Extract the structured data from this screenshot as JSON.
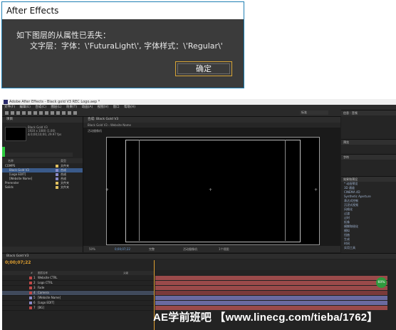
{
  "dialog": {
    "title": "After Effects",
    "message_line1": "如下图层的从属性已丢失：",
    "message_line2": "文字层：字体：\\'FuturaLight\\', 字体样式：\\'Regular\\'",
    "ok_label": "确定"
  },
  "ae": {
    "window_title": "Adobe After Effects - Black gold V3 REC Logo.aep *",
    "menu": [
      "文件(F)",
      "编辑(E)",
      "合成(C)",
      "图层(L)",
      "效果(T)",
      "动画(A)",
      "视图(V)",
      "窗口",
      "帮助(H)"
    ],
    "workspace": "标准",
    "search_placeholder": "搜索帮助",
    "project": {
      "tab": "项目",
      "comp_name": "Black Gold V3",
      "comp_meta": [
        "1920 x 1080 (1.00)",
        "Δ 0;00;10;00, 29.97 fps"
      ],
      "columns": [
        "名称",
        "类型"
      ],
      "items": [
        {
          "name": "COMPS",
          "type": "文件夹",
          "color": "#e0c060",
          "selected": false
        },
        {
          "name": "Black Gold V3",
          "type": "合成",
          "color": "#8a8ac8",
          "selected": true
        },
        {
          "name": "[Logo EDIT]",
          "type": "合成",
          "color": "#8a8ac8",
          "selected": false
        },
        {
          "name": "[Website Name]",
          "type": "合成",
          "color": "#8a8ac8",
          "selected": false
        },
        {
          "name": "Prerender",
          "type": "文件夹",
          "color": "#e0c060",
          "selected": false
        },
        {
          "name": "Solids",
          "type": "文件夹",
          "color": "#e0c060",
          "selected": false
        }
      ]
    },
    "comp": {
      "tab": "合成: Black Gold V3",
      "sub_tab": "Black Gold V3 ‹ Website Name",
      "label": "活动摄像机",
      "zoom": "50%",
      "timecode": "0;00;07;22",
      "resolution": "完整",
      "view": "1个视图"
    },
    "right_panels": {
      "info": "信息",
      "audio": "音频",
      "preview": "预览",
      "character": "字符",
      "effects": "效果和预设",
      "effects_list": [
        "* 动画预设",
        "3D 通道",
        "CINEMA 4D",
        "Synthetic Aperture",
        "表达式控制",
        "沉浸式视频",
        "风格化",
        "过渡",
        "过时",
        "抠像",
        "模糊和锐化",
        "模拟",
        "扭曲",
        "生成",
        "时间",
        "实用工具"
      ]
    },
    "timeline": {
      "tab": "Black Gold V3",
      "time": "0;00;07;22",
      "layer_cols": [
        "#",
        "图层名称",
        "父级"
      ],
      "layers": [
        {
          "n": "1",
          "name": "Website CTRL",
          "color": "#c04848",
          "selected": false
        },
        {
          "n": "2",
          "name": "Logo CTRL",
          "color": "#c04848",
          "selected": false
        },
        {
          "n": "3",
          "name": "Fade",
          "color": "#c04848",
          "selected": false
        },
        {
          "n": "4",
          "name": "Camera",
          "color": "#c04848",
          "selected": true
        },
        {
          "n": "5",
          "name": "[Website Name]",
          "color": "#8a8ac8",
          "selected": false
        },
        {
          "n": "6",
          "name": "[Logo EDIT]",
          "color": "#8a8ac8",
          "selected": false
        },
        {
          "n": "7",
          "name": "[BG]",
          "color": "#c04848",
          "selected": false
        }
      ],
      "ram_preview": "60%"
    }
  },
  "watermark": "AE学前班吧  【www.linecg.com/tieba/1762】"
}
